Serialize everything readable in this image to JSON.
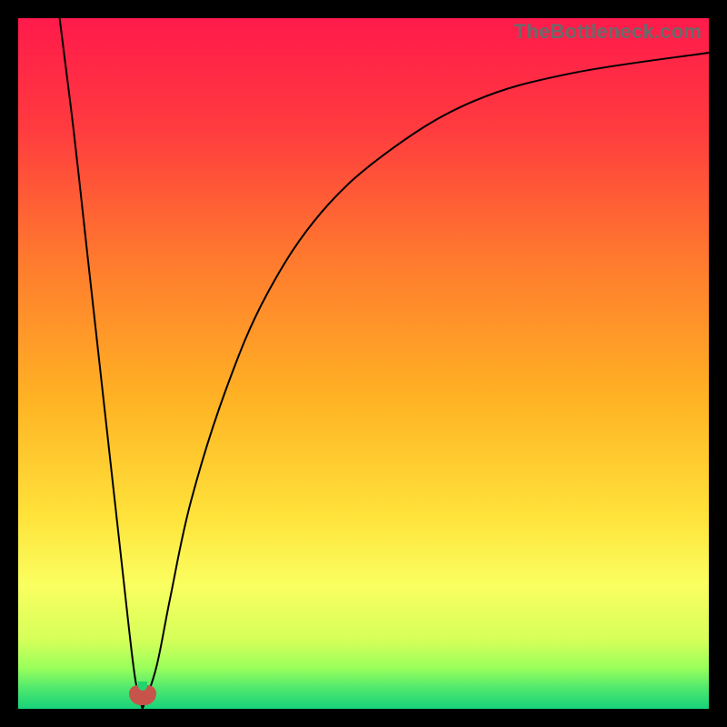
{
  "watermark": {
    "text": "TheBottleneck.com"
  },
  "colors": {
    "black": "#000000",
    "gradient_stops": [
      {
        "pct": 0,
        "color": "#ff1a4b"
      },
      {
        "pct": 16,
        "color": "#ff3b3f"
      },
      {
        "pct": 35,
        "color": "#ff7a2e"
      },
      {
        "pct": 55,
        "color": "#ffb224"
      },
      {
        "pct": 72,
        "color": "#ffe23a"
      },
      {
        "pct": 82,
        "color": "#faff60"
      },
      {
        "pct": 90,
        "color": "#d6ff5a"
      },
      {
        "pct": 94,
        "color": "#9bff5a"
      },
      {
        "pct": 97,
        "color": "#4fe86e"
      },
      {
        "pct": 100,
        "color": "#17d27a"
      }
    ],
    "blob": "#c6544a",
    "stroke": "#000000"
  },
  "chart_data": {
    "type": "line",
    "title": "",
    "xlabel": "",
    "ylabel": "",
    "xlim": [
      0,
      100
    ],
    "ylim": [
      0,
      100
    ],
    "note": "Values are percentages of plot width (x) and height from bottom (y). Two branches of a bottleneck curve meeting near x≈18.",
    "series": [
      {
        "name": "left-branch",
        "x": [
          6,
          8,
          10,
          12,
          14,
          16,
          17,
          18
        ],
        "y": [
          100,
          84,
          66,
          48,
          30,
          12,
          4,
          0
        ]
      },
      {
        "name": "right-branch",
        "x": [
          18,
          20,
          22,
          25,
          30,
          36,
          44,
          54,
          66,
          80,
          100
        ],
        "y": [
          0,
          6,
          16,
          30,
          46,
          60,
          72,
          81,
          88,
          92,
          95
        ]
      }
    ],
    "marker": {
      "name": "bottleneck-minimum",
      "x": 18,
      "y": 1
    }
  }
}
